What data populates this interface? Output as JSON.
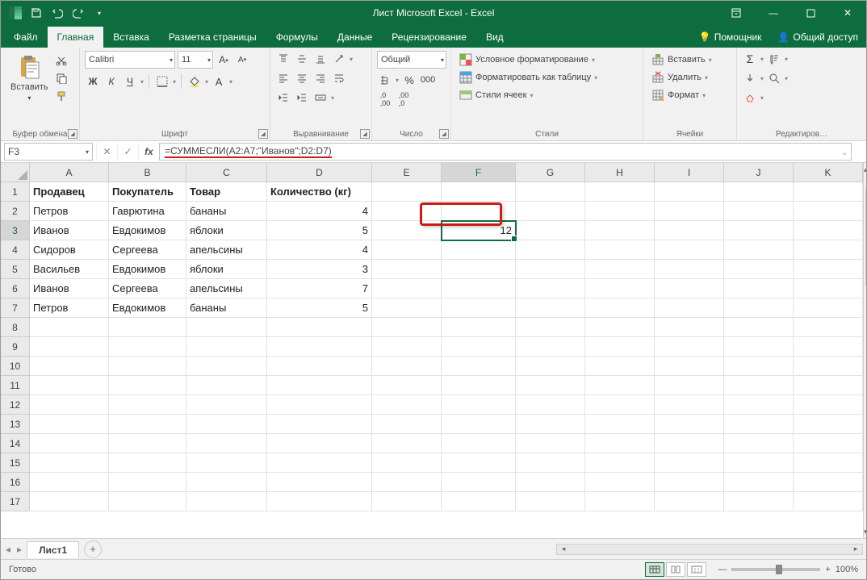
{
  "title": "Лист Microsoft Excel - Excel",
  "qat": {
    "save": "save-icon",
    "undo": "undo-icon",
    "redo": "redo-icon"
  },
  "winctrls": {
    "opts": "▢",
    "min": "—",
    "max": "☐",
    "close": "✕"
  },
  "tabs": [
    "Файл",
    "Главная",
    "Вставка",
    "Разметка страницы",
    "Формулы",
    "Данные",
    "Рецензирование",
    "Вид"
  ],
  "active_tab": "Главная",
  "tab_help": "Помощник",
  "tab_share": "Общий доступ",
  "ribbon": {
    "clipboard": {
      "paste": "Вставить",
      "label": "Буфер обмена"
    },
    "font": {
      "name": "Calibri",
      "size": "11",
      "label": "Шрифт",
      "bold": "Ж",
      "italic": "К",
      "underline": "Ч"
    },
    "align": {
      "label": "Выравнивание"
    },
    "number": {
      "format": "Общий",
      "label": "Число"
    },
    "styles": {
      "cond": "Условное форматирование",
      "table": "Форматировать как таблицу",
      "cell": "Стили ячеек",
      "label": "Стили"
    },
    "cells": {
      "insert": "Вставить",
      "delete": "Удалить",
      "format": "Формат",
      "label": "Ячейки"
    },
    "edit": {
      "label": "Редактиров…"
    }
  },
  "namebox": "F3",
  "formula": "=СУММЕСЛИ(A2:A7;\"Иванов\";D2:D7)",
  "columns": [
    "A",
    "B",
    "C",
    "D",
    "E",
    "F",
    "G",
    "H",
    "I",
    "J",
    "K"
  ],
  "rowcount": 17,
  "headers": [
    "Продавец",
    "Покупатель",
    "Товар",
    "Количество (кг)"
  ],
  "data": [
    [
      "Петров",
      "Гаврютина",
      "бананы",
      "4"
    ],
    [
      "Иванов",
      "Евдокимов",
      "яблоки",
      "5"
    ],
    [
      "Сидоров",
      "Сергеева",
      "апельсины",
      "4"
    ],
    [
      "Васильев",
      "Евдокимов",
      "яблоки",
      "3"
    ],
    [
      "Иванов",
      "Сергеева",
      "апельсины",
      "7"
    ],
    [
      "Петров",
      "Евдокимов",
      "бананы",
      "5"
    ]
  ],
  "result_cell": {
    "col": "F",
    "row": 3,
    "value": "12"
  },
  "sheet_tab": "Лист1",
  "status_text": "Готово",
  "zoom": "100%"
}
